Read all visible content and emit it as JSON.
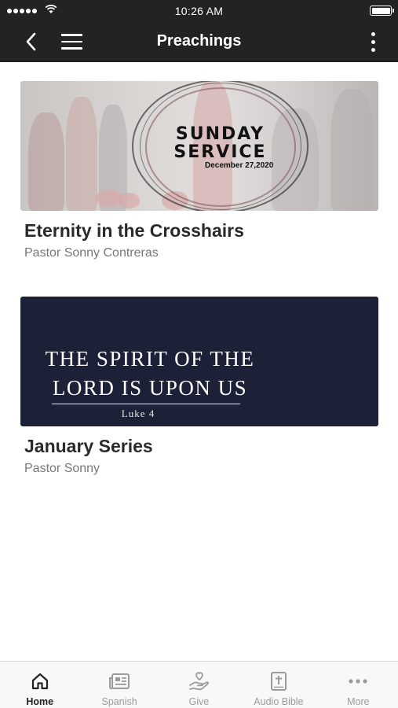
{
  "status_bar": {
    "time": "10:26 AM"
  },
  "nav": {
    "title": "Preachings"
  },
  "cards": [
    {
      "title": "Eternity in the Crosshairs",
      "subtitle": "Pastor Sonny Contreras",
      "thumbnail": {
        "heading_line_1": "SUNDAY",
        "heading_line_2": "SERVICE",
        "date": "December 27,2020"
      }
    },
    {
      "title": "January Series",
      "subtitle": "Pastor Sonny",
      "thumbnail": {
        "line_1": "THE SPIRIT OF THE",
        "line_2": "LORD IS UPON US",
        "verse": "Luke 4",
        "background_color": "#1d2137"
      }
    }
  ],
  "tabs": [
    {
      "label": "Home",
      "icon": "home-icon",
      "active": true
    },
    {
      "label": "Spanish",
      "icon": "news-icon",
      "active": false
    },
    {
      "label": "Give",
      "icon": "give-heart-icon",
      "active": false
    },
    {
      "label": "Audio Bible",
      "icon": "bible-icon",
      "active": false
    },
    {
      "label": "More",
      "icon": "more-dots-icon",
      "active": false
    }
  ],
  "colors": {
    "header_background": "#232323",
    "tab_active": "#222222",
    "tab_inactive": "#9b9b9b"
  }
}
